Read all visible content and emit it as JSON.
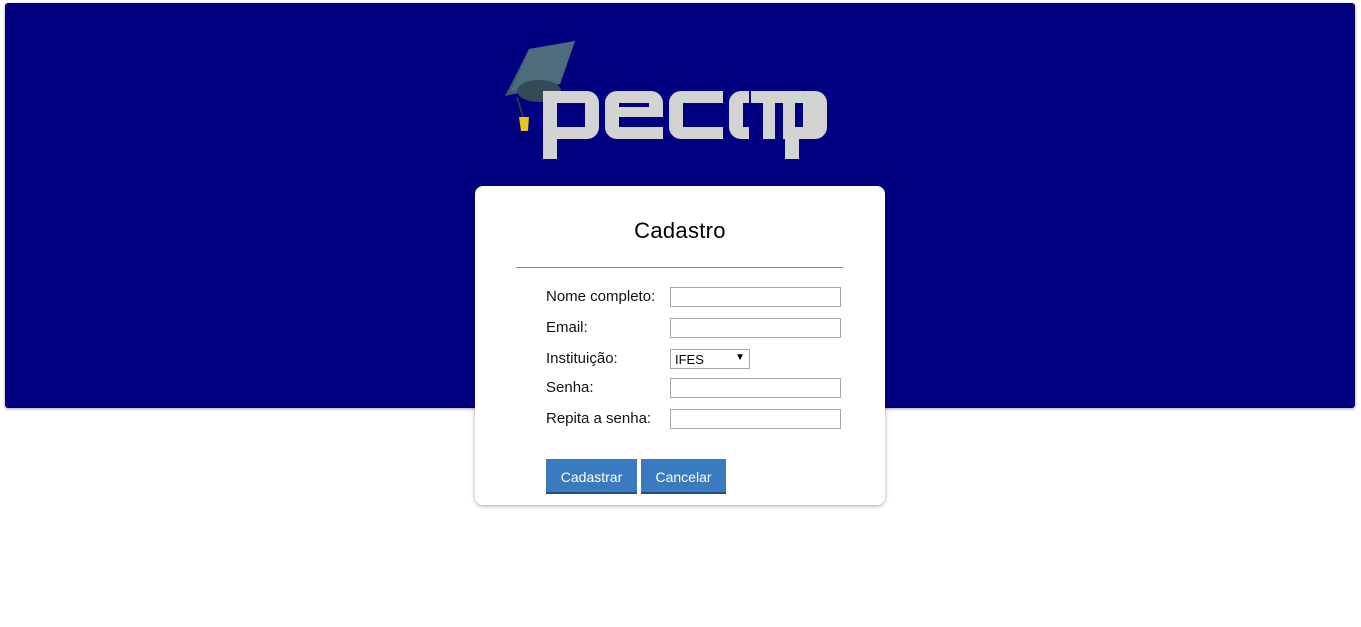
{
  "colors": {
    "banner_bg": "#000080",
    "button_bg": "#3a7bbf",
    "logo_text": "#d3d3d3"
  },
  "logo": {
    "text": "pecomp",
    "icon": "graduation-cap-icon"
  },
  "form": {
    "title": "Cadastro",
    "fields": {
      "nome": {
        "label": "Nome completo:",
        "value": ""
      },
      "email": {
        "label": "Email:",
        "value": ""
      },
      "instituicao": {
        "label": "Instituição:",
        "selected": "IFES"
      },
      "senha": {
        "label": "Senha:",
        "value": ""
      },
      "repita": {
        "label": "Repita a senha:",
        "value": ""
      }
    },
    "buttons": {
      "submit": "Cadastrar",
      "cancel": "Cancelar"
    }
  }
}
